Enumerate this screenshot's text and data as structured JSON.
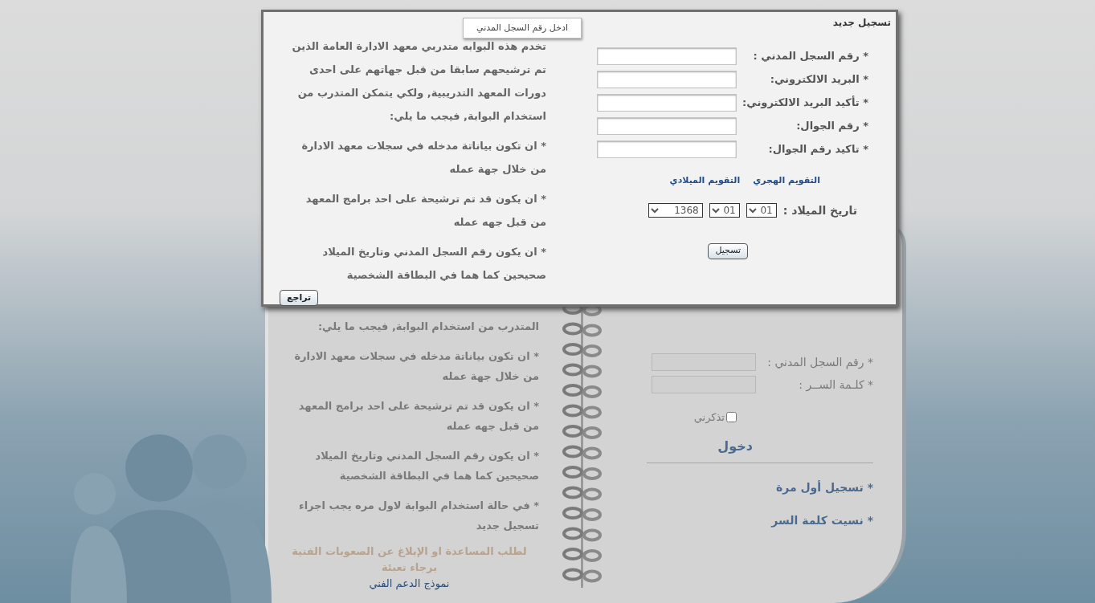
{
  "dialog": {
    "title": "تسجيل جديد",
    "tooltip": "ادخل رقم السجل المدني",
    "intro": "تخدم هذه البوابه متدربي معهد الادارة العامة الذين تم ترشيحهم سابقا من قبل جهاتهم على احدى دورات المعهد التدريبية, ولكي يتمكن المتدرب من استخدام البوابة, فيجب ما يلي:",
    "conditions": [
      "* ان تكون بياناتة مدخله في سجلات معهد الادارة من خلال جهة عمله",
      "* ان يكون قد تم ترشيحة على احد برامج المعهد من قبل جهه عمله",
      "* ان يكون رقم السجل المدني وتاريخ الميلاد صحيحين كما هما في البطاقة الشخصية"
    ],
    "fields": [
      {
        "label": "* رقم السجل المدني :"
      },
      {
        "label": "* البريد الالكتروني:"
      },
      {
        "label": "* تأكيد البريد الالكتروني:"
      },
      {
        "label": "* رقم الجوال:"
      },
      {
        "label": "* تاكيد رقم الجوال:"
      }
    ],
    "calendar_links": [
      "التقويم الهجري",
      "التقويم الميلادي"
    ],
    "birth_date": {
      "label": "تاريخ الميلاد :",
      "day": "01",
      "month": "01",
      "year": "1368"
    },
    "submit": "تسجيل",
    "back": "تراجع"
  },
  "page": {
    "intro_tail": "المتدرب من استخدام البوابة, فيجب ما يلي:",
    "conditions": [
      "* ان تكون بياناتة مدخله في سجلات معهد الادارة من خلال جهة عمله",
      "* ان يكون قد تم ترشيحة على احد برامج المعهد من قبل جهه عمله",
      "* ان يكون رقم السجل المدني وتاريخ الميلاد صحيحين كما هما في البطاقة الشخصية",
      "* في حالة استخدام البوابة لاول مره يجب اجراء تسجيل جديد"
    ],
    "help_text": "لطلب المساعدة او الإبلاغ عن الصعوبات الفنية برجاء تعبئة",
    "help_link": "نموذج الدعم الفني",
    "login": {
      "fields": [
        {
          "label": "* رقم السجل المدني :"
        },
        {
          "label": "* كلـمة الســر :"
        }
      ],
      "remember": {
        "label": "تذكرني",
        "checked": false
      },
      "submit": "دخول",
      "links": [
        "* تسجيل أول مرة",
        "* نسيت كلمة السر"
      ]
    }
  }
}
